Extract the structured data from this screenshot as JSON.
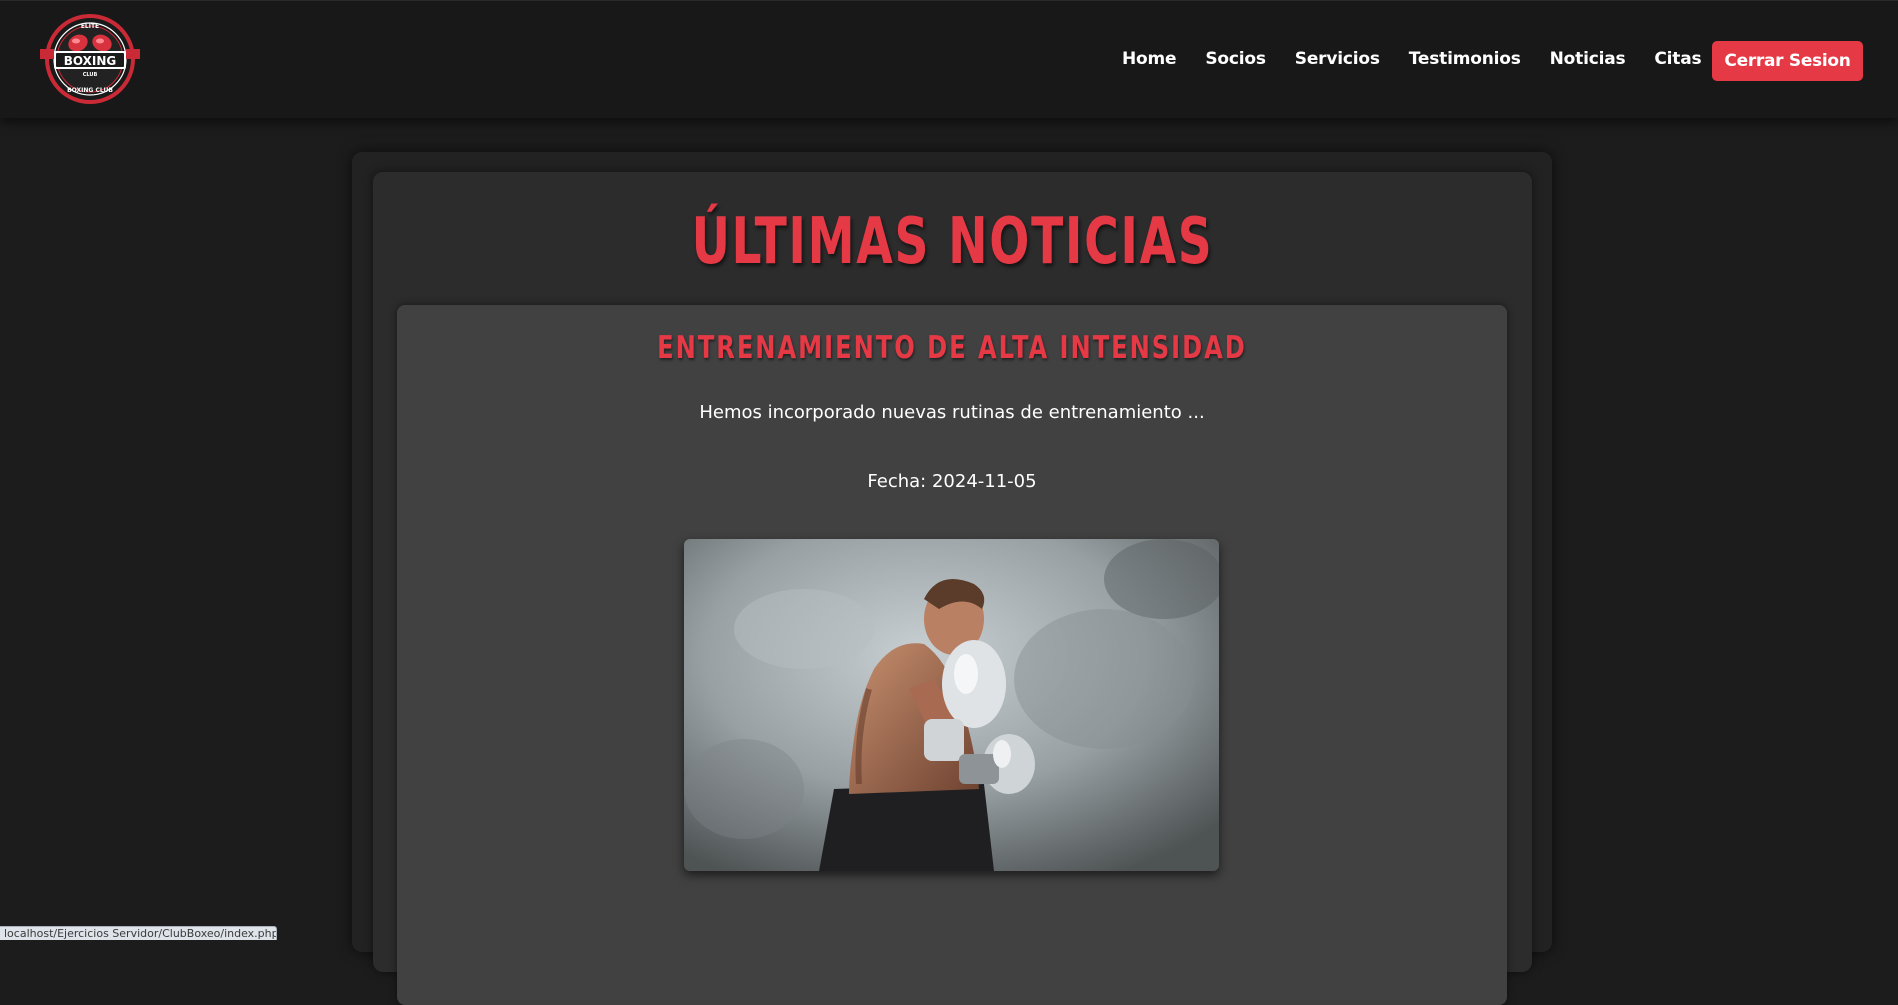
{
  "header": {
    "logo": {
      "icon": "boxing-gloves-emblem",
      "top_text": "ELITE",
      "main_text": "BOXING",
      "sub_text": "CLUB",
      "ring_text": "BOXING CLUB"
    },
    "nav": [
      {
        "label": "Home"
      },
      {
        "label": "Socios"
      },
      {
        "label": "Servicios"
      },
      {
        "label": "Testimonios"
      },
      {
        "label": "Noticias"
      },
      {
        "label": "Citas"
      }
    ],
    "logout_label": "Cerrar Sesion"
  },
  "main": {
    "title": "ÚLTIMAS NOTICIAS",
    "news": [
      {
        "title": "ENTRENAMIENTO DE ALTA INTENSIDAD",
        "summary": "Hemos incorporado nuevas rutinas de entrenamiento ...",
        "date": "Fecha: 2024-11-05",
        "image_icon": "boxer-photo"
      }
    ]
  },
  "status_bar": {
    "url": "localhost/Ejercicios Servidor/ClubBoxeo/index.php"
  },
  "colors": {
    "accent": "#e63946",
    "background": "#1c1c1c",
    "navbar": "#181818",
    "panel": "#2c2c2c",
    "card": "#414141"
  }
}
